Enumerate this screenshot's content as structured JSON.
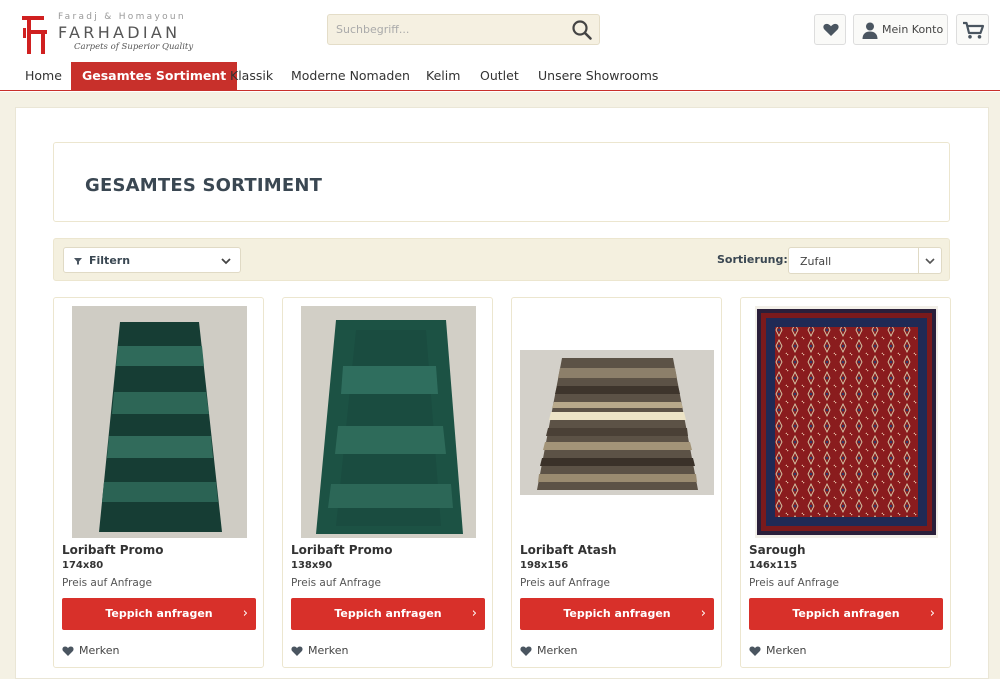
{
  "header": {
    "logo": {
      "top_text": "Faradj & Homayoun",
      "main_text": "FARHADIAN",
      "tagline": "Carpets of Superior Quality"
    },
    "search": {
      "placeholder": "Suchbegriff..."
    },
    "account_label": "Mein Konto"
  },
  "nav": {
    "items": [
      {
        "label": "Home"
      },
      {
        "label": "Gesamtes Sortiment",
        "active": true
      },
      {
        "label": "Klassik"
      },
      {
        "label": "Moderne Nomaden"
      },
      {
        "label": "Kelim"
      },
      {
        "label": "Outlet"
      },
      {
        "label": "Unsere Showrooms"
      }
    ]
  },
  "main": {
    "page_title": "GESAMTES SORTIMENT",
    "filter_label": "Filtern",
    "sort_label": "Sortierung:",
    "sort_value": "Zufall",
    "products": [
      {
        "name": "Loribaft Promo",
        "size": "174x80",
        "price": "Preis auf Anfrage",
        "cta": "Teppich anfragen",
        "wish": "Merken"
      },
      {
        "name": "Loribaft Promo",
        "size": "138x90",
        "price": "Preis auf Anfrage",
        "cta": "Teppich anfragen",
        "wish": "Merken"
      },
      {
        "name": "Loribaft Atash",
        "size": "198x156",
        "price": "Preis auf Anfrage",
        "cta": "Teppich anfragen",
        "wish": "Merken"
      },
      {
        "name": "Sarough",
        "size": "146x115",
        "price": "Preis auf Anfrage",
        "cta": "Teppich anfragen",
        "wish": "Merken"
      }
    ]
  },
  "colors": {
    "brand_red": "#c8302b",
    "cta_red": "#d8302a",
    "beige": "#f4f1e4",
    "title_slate": "#3a4752"
  }
}
